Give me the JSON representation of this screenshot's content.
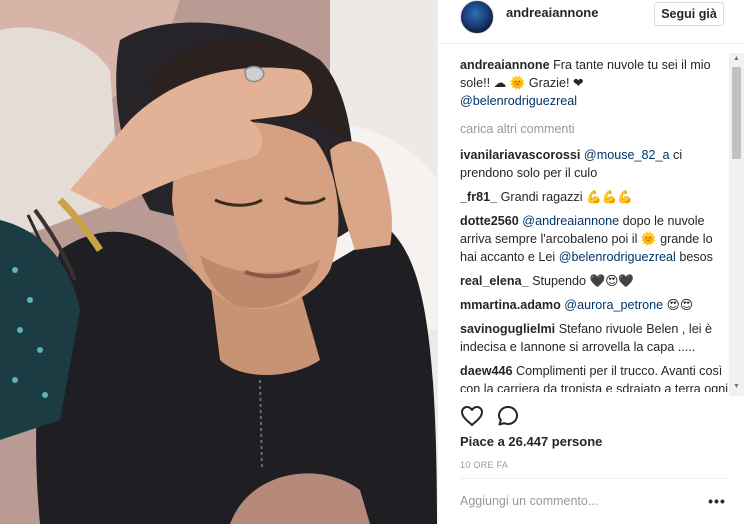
{
  "post": {
    "username": "andreaiannone",
    "follow_label": "Segui già",
    "likes_text": "Piace a 26.447 persone",
    "timestamp": "10 ORE FA",
    "comment_placeholder": "Aggiungi un commento...",
    "more_label": "•••",
    "load_more_label": "carica altri commenti"
  },
  "caption": {
    "user": "andreaiannone",
    "text": "Fra tante nuvole tu sei il mio sole!! ☁ 🌞 Grazie! ❤",
    "mention": "@belenrodriguezreal"
  },
  "comments": [
    {
      "user": "ivanilariavascorossi",
      "mention": "@mouse_82_a",
      "text": " ci prendono solo per il culo"
    },
    {
      "user": "_fr81_",
      "mention": "",
      "text": "Grandi ragazzi 💪💪💪"
    },
    {
      "user": "dotte2560",
      "mention": "@andreaiannone",
      "text": " dopo le nuvole arriva sempre l'arcobaleno poi il 🌞 grande lo hai accanto e Lei",
      "mention2": "@belenrodriguezreal",
      "text2": " besos"
    },
    {
      "user": "real_elena_",
      "mention": "",
      "text": "Stupendo 🖤😍🖤"
    },
    {
      "user": "mmartina.adamo",
      "mention": "@aurora_petrone",
      "text": " 😍😍"
    },
    {
      "user": "savinoguglielmi",
      "mention": "",
      "text": "Stefano rivuole Belen , lei è indecisa e Iannone si arrovella la capa ....."
    },
    {
      "user": "daew446",
      "mention": "",
      "text": "Complimenti per il trucco. Avanti così con la carriera da tronista e sdraiato a terra ogni gara"
    }
  ],
  "icons": {
    "heart": "heart-icon",
    "comment": "comment-icon"
  },
  "colors": {
    "mention": "#003569",
    "muted": "#999999",
    "text": "#262626"
  }
}
